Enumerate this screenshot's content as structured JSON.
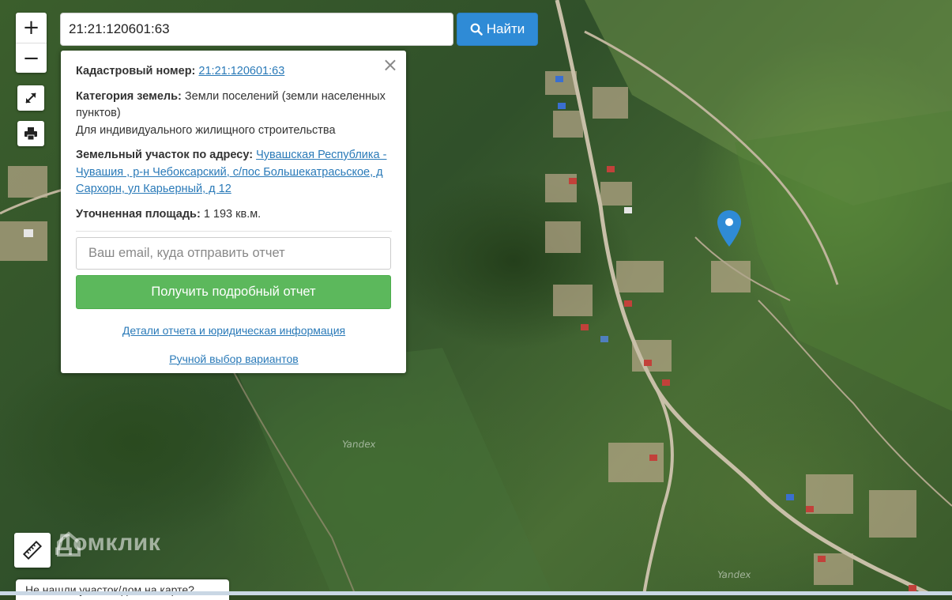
{
  "search": {
    "value": "21:21:120601:63",
    "button_label": "Найти"
  },
  "controls": {
    "zoom_in": "+",
    "zoom_out": "−"
  },
  "popup": {
    "cadastral_label": "Кадастровый номер:",
    "cadastral_value": "21:21:120601:63",
    "category_label": "Категория земель:",
    "category_value": "Земли поселений (земли населенных пунктов)",
    "usage": "Для индивидуального жилищного строительства",
    "address_label": "Земельный участок по адресу:",
    "address_value": "Чувашская Республика - Чувашия , р-н Чебоксарский, с/пос Большекатрасьское, д Сархорн, ул Карьерный, д 12",
    "area_label": "Уточненная площадь:",
    "area_value": "1 193 кв.м.",
    "email_placeholder": "Ваш email, куда отправить отчет",
    "report_button": "Получить подробный отчет",
    "details_link": "Детали отчета и юридическая информация",
    "manual_link": "Ручной выбор вариантов"
  },
  "map": {
    "watermark_1": "Yandex",
    "watermark_2": "Yandex",
    "brand": "Домклик"
  },
  "bottom": {
    "tip": "Не нашли участок/дом на карте?"
  },
  "colors": {
    "search_button": "#2f8bd6",
    "report_button": "#5cb85c",
    "link": "#2a7ab8",
    "marker": "#2f8bd6"
  },
  "icons": [
    "search-icon",
    "zoom-in-icon",
    "zoom-out-icon",
    "fullscreen-icon",
    "print-icon",
    "ruler-icon",
    "close-icon",
    "location-pin-icon"
  ]
}
